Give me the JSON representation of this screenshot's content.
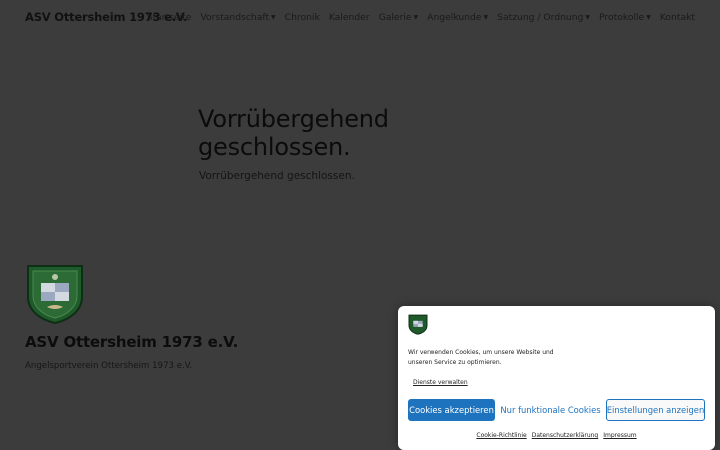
{
  "header": {
    "site_title": "ASV Ottersheim 1973 e.V.",
    "nav": [
      {
        "label": "Startseite",
        "has_submenu": false
      },
      {
        "label": "Vorstandschaft",
        "has_submenu": true
      },
      {
        "label": "Chronik",
        "has_submenu": false
      },
      {
        "label": "Kalender",
        "has_submenu": false
      },
      {
        "label": "Galerie",
        "has_submenu": true
      },
      {
        "label": "Angelkunde",
        "has_submenu": true
      },
      {
        "label": "Satzung / Ordnung",
        "has_submenu": true
      },
      {
        "label": "Protokolle",
        "has_submenu": true
      },
      {
        "label": "Kontakt",
        "has_submenu": false
      }
    ]
  },
  "main": {
    "heading": "Vorrübergehend geschlossen.",
    "text": "Vorrübergehend geschlossen."
  },
  "footer": {
    "title": "ASV Ottersheim 1973 e.V.",
    "subtitle": "Angelsportverein Ottersheim 1973 e.V."
  },
  "cookie": {
    "message": "Wir verwenden Cookies, um unsere Website und unseren Service zu optimieren.",
    "manage_link": "Dienste verwalten",
    "accept_button": "Cookies akzeptieren",
    "functional_button": "Nur funktionale Cookies",
    "settings_button": "Einstellungen anzeigen",
    "links": [
      "Cookie-Richtlinie",
      "Datenschutzerklärung",
      "Impressum"
    ]
  },
  "colors": {
    "overlay_background": "#3c3c3c",
    "accent": "#1e73be",
    "logo_green": "#1f5a2a"
  }
}
